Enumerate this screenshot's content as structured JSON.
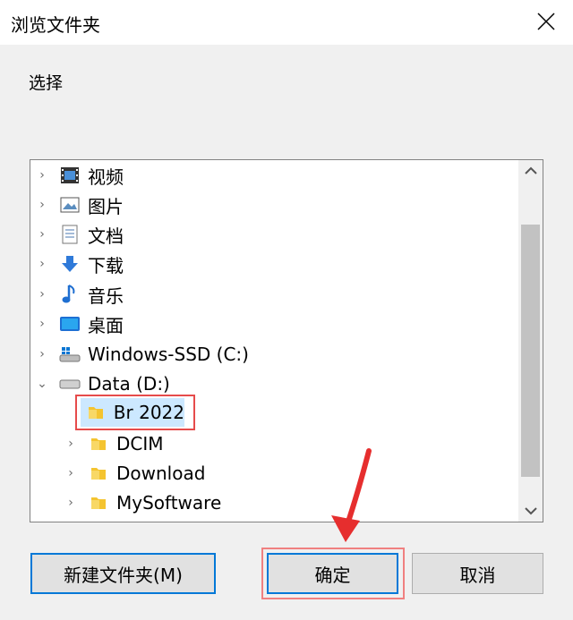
{
  "dialog": {
    "title": "浏览文件夹",
    "prompt": "选择"
  },
  "tree": {
    "items": [
      {
        "label": "视频",
        "icon": "video-icon",
        "expanded": false,
        "level": 0
      },
      {
        "label": "图片",
        "icon": "pictures-icon",
        "expanded": false,
        "level": 0
      },
      {
        "label": "文档",
        "icon": "documents-icon",
        "expanded": false,
        "level": 0
      },
      {
        "label": "下载",
        "icon": "download-icon",
        "expanded": false,
        "level": 0
      },
      {
        "label": "音乐",
        "icon": "music-icon",
        "expanded": false,
        "level": 0
      },
      {
        "label": "桌面",
        "icon": "desktop-icon",
        "expanded": false,
        "level": 0
      },
      {
        "label": "Windows-SSD (C:)",
        "icon": "windows-drive-icon",
        "expanded": false,
        "level": 0
      },
      {
        "label": "Data (D:)",
        "icon": "drive-icon",
        "expanded": true,
        "level": 0
      },
      {
        "label": "Br 2022",
        "icon": "folder-icon",
        "selected": true,
        "level": 1
      },
      {
        "label": "DCIM",
        "icon": "folder-icon",
        "expanded": false,
        "level": 1
      },
      {
        "label": "Download",
        "icon": "folder-icon",
        "expanded": false,
        "level": 1
      },
      {
        "label": "MySoftware",
        "icon": "folder-icon",
        "expanded": false,
        "level": 1
      }
    ]
  },
  "buttons": {
    "new_folder": "新建文件夹(M)",
    "ok": "确定",
    "cancel": "取消"
  },
  "colors": {
    "accent": "#0078d7",
    "selection": "#cce8ff",
    "annotation": "#e64b4b"
  }
}
